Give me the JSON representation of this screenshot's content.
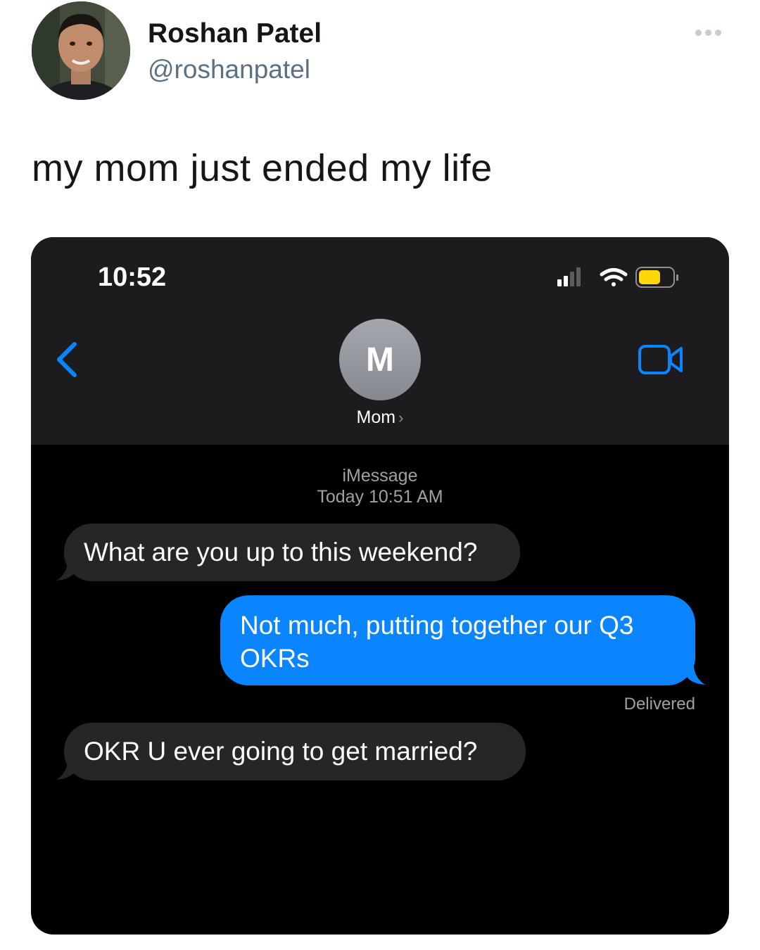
{
  "tweet": {
    "display_name": "Roshan Patel",
    "handle": "@roshanpatel",
    "text": "my mom just ended my life"
  },
  "phone": {
    "status_bar": {
      "time": "10:52",
      "battery_color": "#ffd60a"
    },
    "conversation_header": {
      "avatar_initial": "M",
      "contact_name": "Mom",
      "chevron": "›",
      "accent_color": "#0a84ff"
    },
    "thread": {
      "service": "iMessage",
      "timestamp": "Today 10:51 AM",
      "messages": [
        {
          "direction": "received",
          "text": "What are you up to this weekend?"
        },
        {
          "direction": "sent",
          "text": "Not much, putting together our Q3 OKRs"
        },
        {
          "direction": "received",
          "text": "OKR U ever going to get married?"
        }
      ],
      "delivery_status": "Delivered"
    }
  }
}
